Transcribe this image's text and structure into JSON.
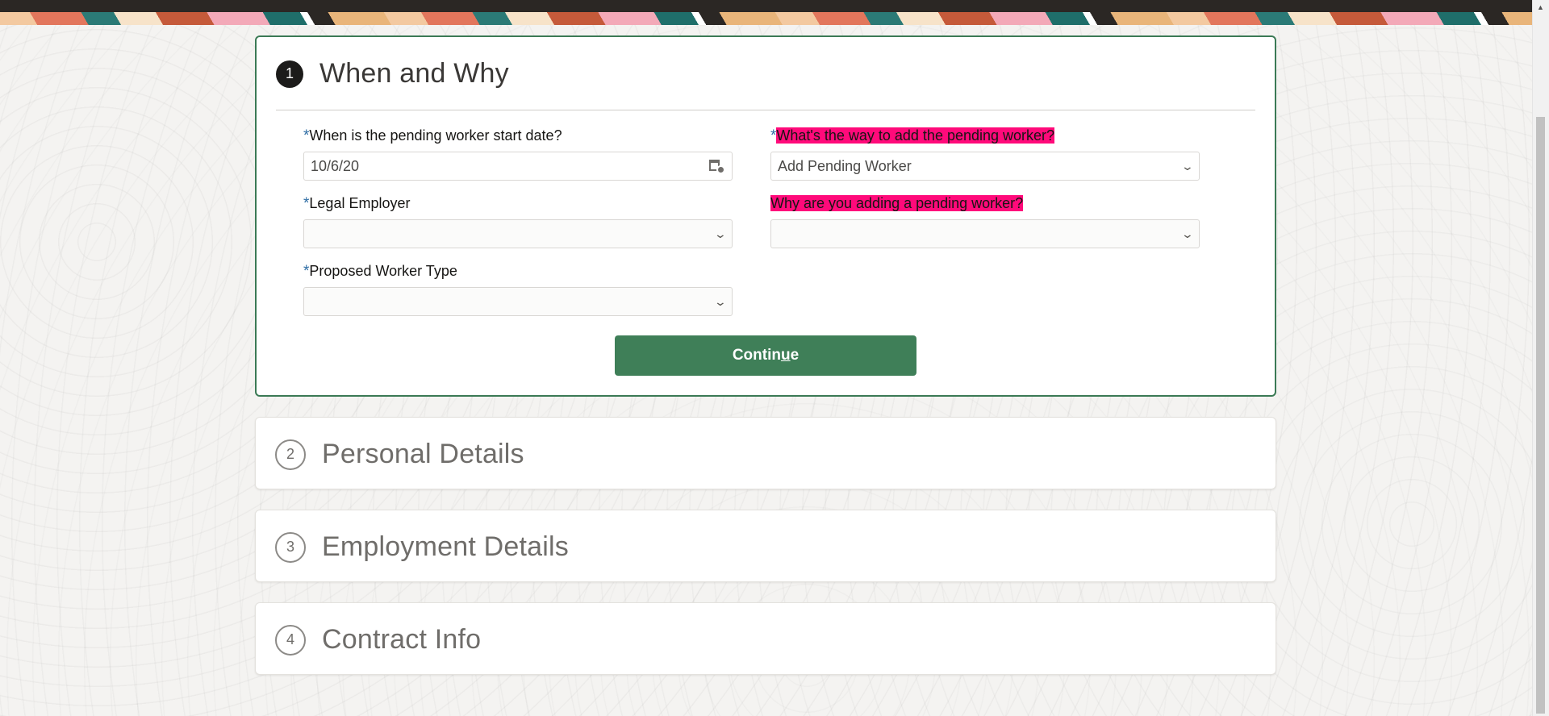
{
  "steps": [
    {
      "number": "1",
      "title": "When and Why"
    },
    {
      "number": "2",
      "title": "Personal Details"
    },
    {
      "number": "3",
      "title": "Employment Details"
    },
    {
      "number": "4",
      "title": "Contract Info"
    }
  ],
  "form": {
    "required_marker": "*",
    "start_date": {
      "label": "When is the pending worker start date?",
      "value": "10/6/20"
    },
    "add_way": {
      "label": "What's the way to add the pending worker?",
      "value": "Add Pending Worker"
    },
    "legal_employer": {
      "label": "Legal Employer",
      "value": ""
    },
    "reason": {
      "label": "Why are you adding a pending worker?",
      "value": ""
    },
    "worker_type": {
      "label": "Proposed Worker Type",
      "value": ""
    },
    "continue": {
      "pre": "Contin",
      "underlined": "u",
      "post": "e"
    }
  },
  "colors": {
    "accent_green": "#3f7f58",
    "highlight_pink": "#ff0a7a",
    "required_blue": "#2e6da4"
  },
  "icons": [
    "calendar-icon",
    "chevron-down-icon",
    "scroll-up-arrow-icon"
  ]
}
